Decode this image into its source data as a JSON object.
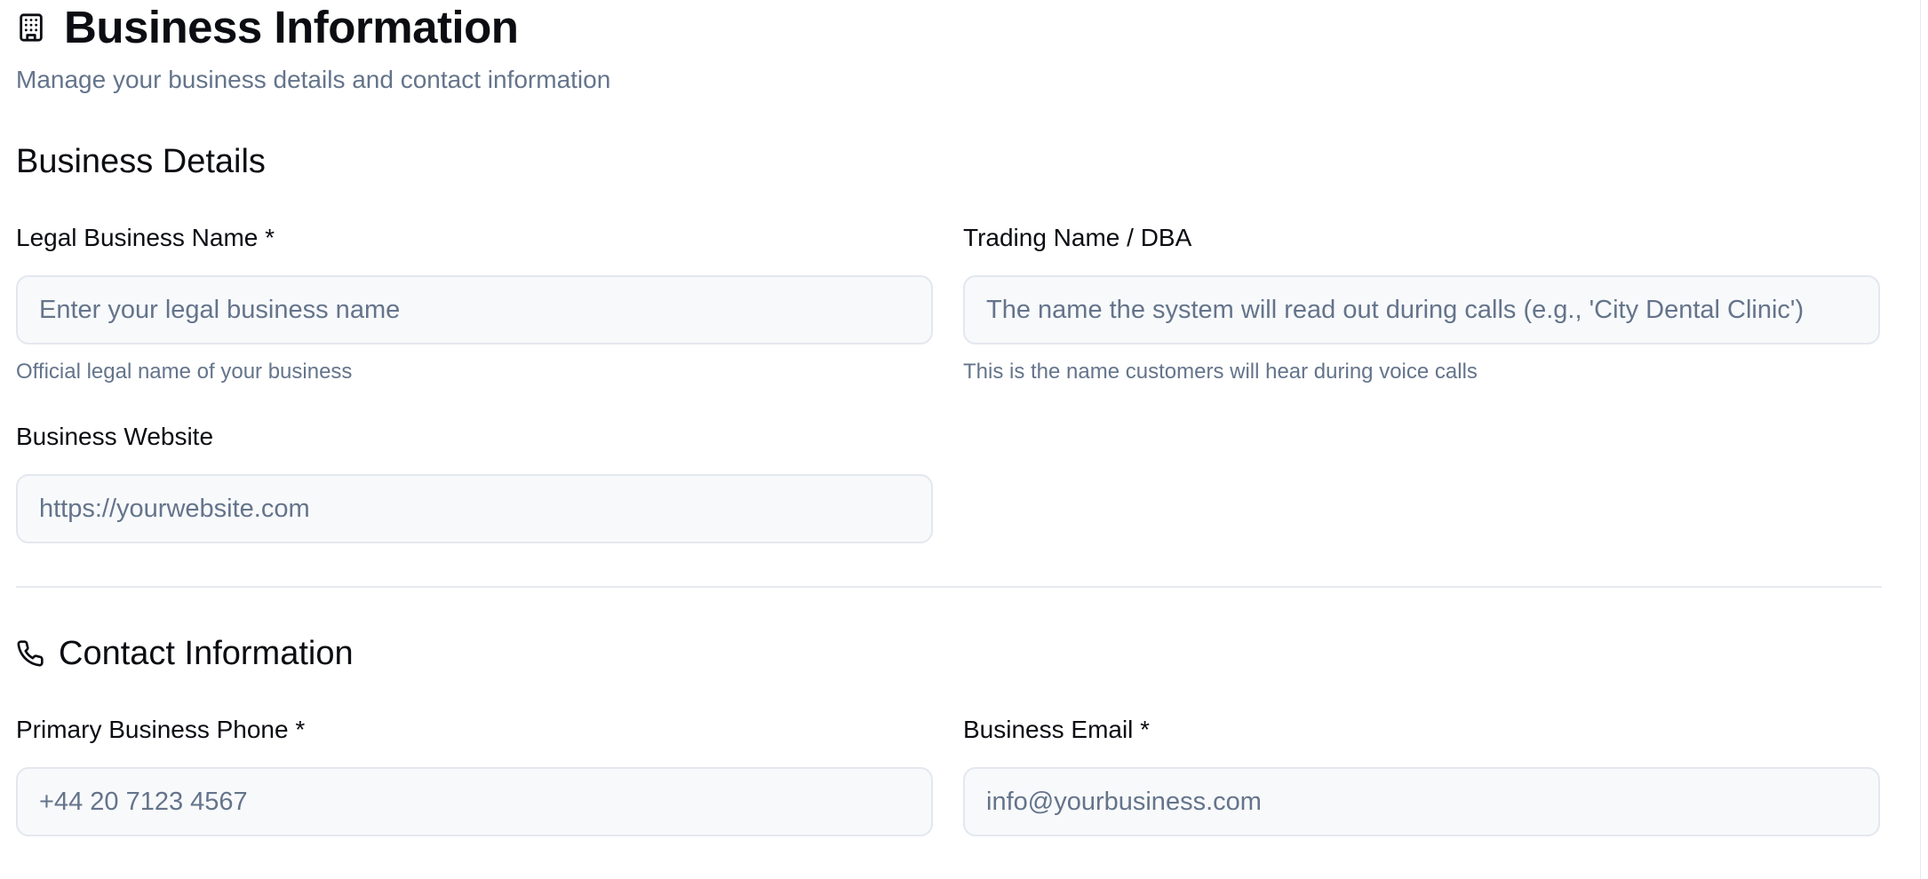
{
  "header": {
    "title": "Business Information",
    "subtitle": "Manage your business details and contact information",
    "icon": "building-icon"
  },
  "business_details": {
    "section_title": "Business Details",
    "legal_name": {
      "label": "Legal Business Name *",
      "placeholder": "Enter your legal business name",
      "value": "",
      "hint": "Official legal name of your business"
    },
    "trading_name": {
      "label": "Trading Name / DBA",
      "placeholder": "The name the system will read out during calls (e.g., 'City Dental Clinic')",
      "value": "",
      "hint": "This is the name customers will hear during voice calls"
    },
    "website": {
      "label": "Business Website",
      "placeholder": "https://yourwebsite.com",
      "value": ""
    }
  },
  "contact_information": {
    "section_title": "Contact Information",
    "icon": "phone-icon",
    "phone": {
      "label": "Primary Business Phone *",
      "placeholder": "+44 20 7123 4567",
      "value": ""
    },
    "email": {
      "label": "Business Email *",
      "placeholder": "info@yourbusiness.com",
      "value": ""
    }
  }
}
